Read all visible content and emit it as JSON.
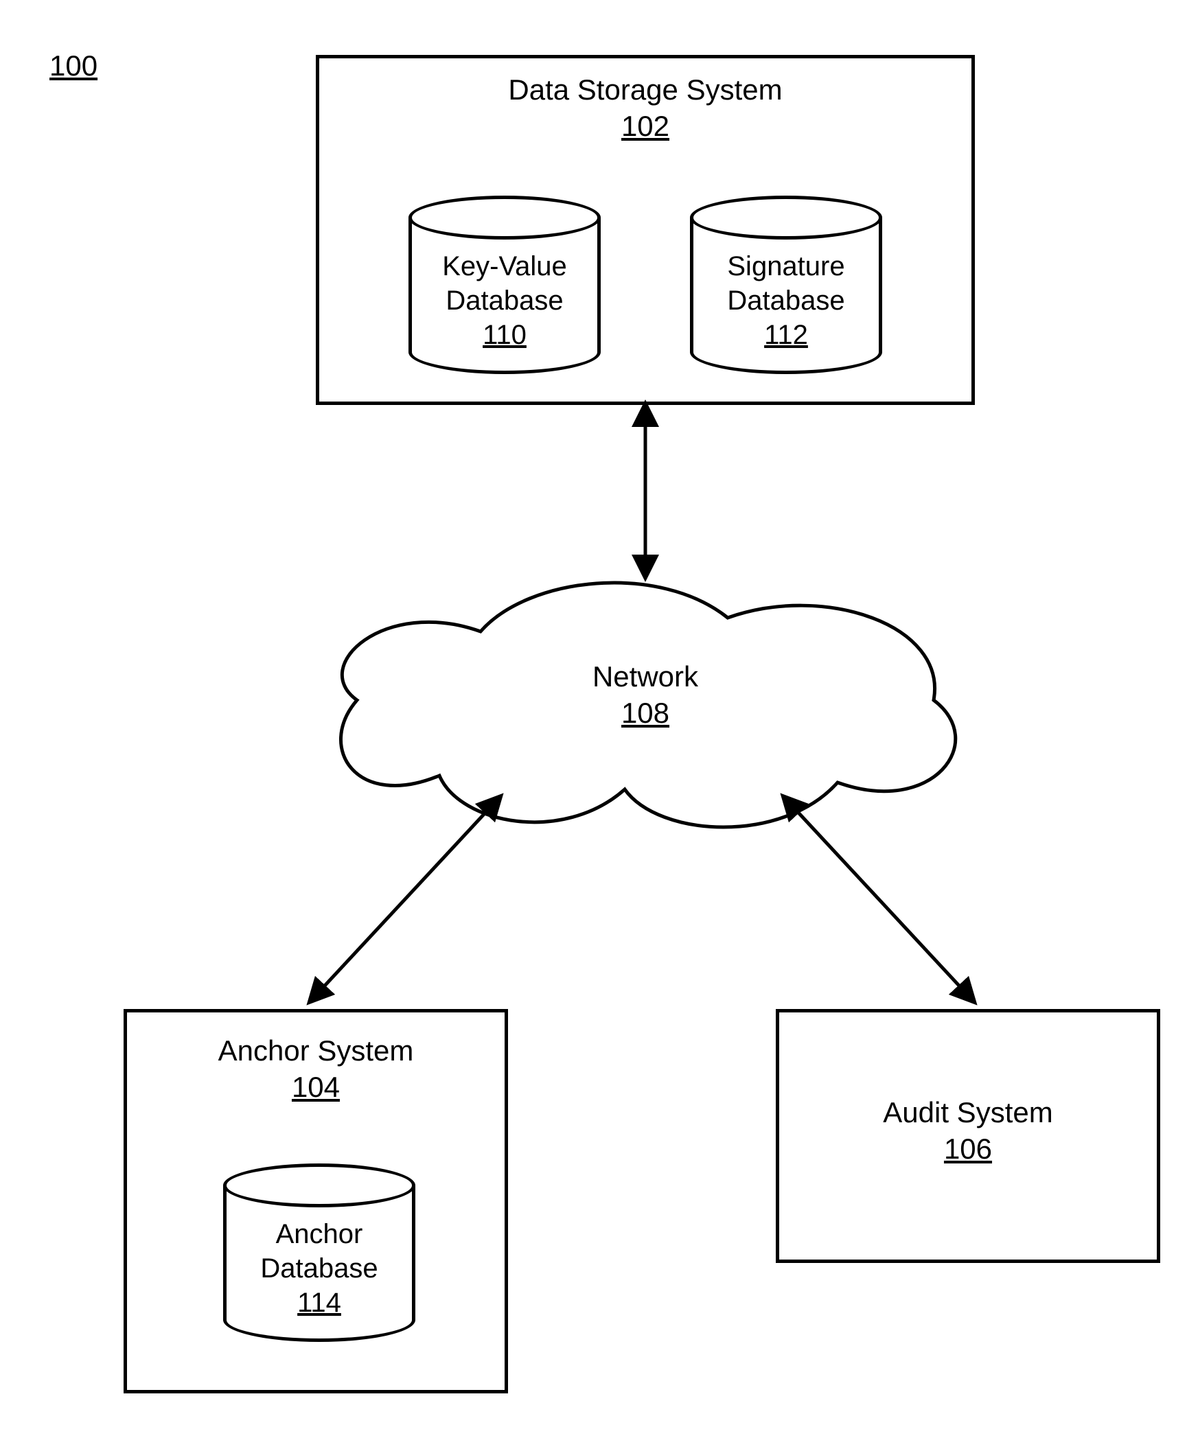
{
  "figure_number": "100",
  "nodes": {
    "data_storage_system": {
      "name": "Data Storage System",
      "ref": "102"
    },
    "key_value_db": {
      "line1": "Key-Value",
      "line2": "Database",
      "ref": "110"
    },
    "signature_db": {
      "line1": "Signature",
      "line2": "Database",
      "ref": "112"
    },
    "network": {
      "name": "Network",
      "ref": "108"
    },
    "anchor_system": {
      "name": "Anchor System",
      "ref": "104"
    },
    "anchor_db": {
      "line1": "Anchor",
      "line2": "Database",
      "ref": "114"
    },
    "audit_system": {
      "name": "Audit System",
      "ref": "106"
    }
  }
}
